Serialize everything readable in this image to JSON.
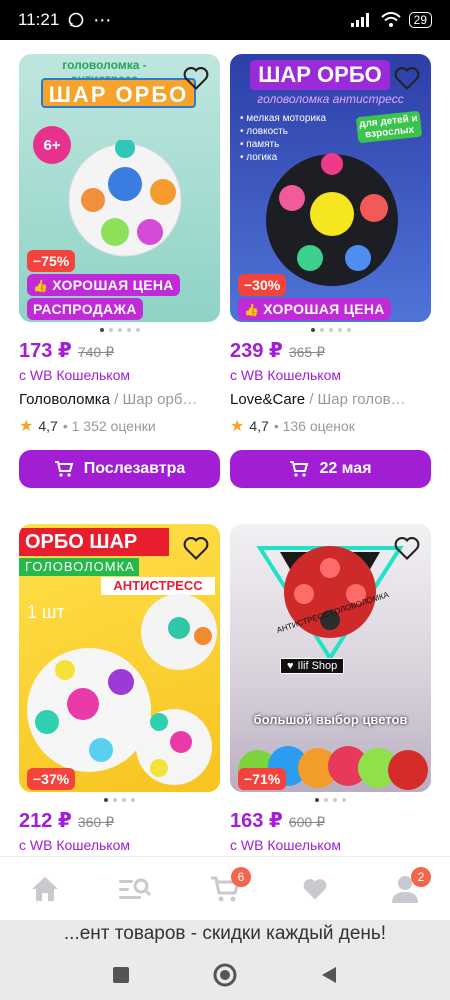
{
  "status": {
    "time": "11:21",
    "battery": "29"
  },
  "products": [
    {
      "img_text_top": "головоломка - антистресс",
      "img_text_main": "ШАР ОРБО",
      "age": "6+",
      "discount": "−75%",
      "tag1": "ХОРОШАЯ ЦЕНА",
      "tag2": "РАСПРОДАЖА",
      "price": "173 ₽",
      "old_price": "740 ₽",
      "wallet": "с WB Кошельком",
      "brand": "Головоломка",
      "name": " / Шар орб…",
      "rating": "4,7",
      "reviews": "• 1 352 оценки",
      "button": "Послезавтра"
    },
    {
      "img_text_main": "ШАР ОРБО",
      "img_text_top": "головоломка антистресс",
      "features": [
        "• мелкая моторика",
        "• ловкость",
        "• память",
        "• логика"
      ],
      "age": "для детей и взрослых",
      "discount": "−30%",
      "tag1": "ХОРОШАЯ ЦЕНА",
      "price": "239 ₽",
      "old_price": "365 ₽",
      "wallet": "с WB Кошельком",
      "brand": "Love&Care",
      "name": " / Шар голов…",
      "rating": "4,7",
      "reviews": "• 136 оценок",
      "button": "22 мая"
    },
    {
      "img_text_top": "ОРБО ШАР",
      "img_text_sub": "ГОЛОВОЛОМКА",
      "img_text_sub2": "АНТИСТРЕСС",
      "qty": "1 шт",
      "discount": "−37%",
      "price": "212 ₽",
      "old_price": "360 ₽",
      "wallet": "с WB Кошельком"
    },
    {
      "shop": "Ilif Shop",
      "ring": "АНТИСТРЕСС ГОЛОВОЛОМКА",
      "img_text_bottom": "большой выбор цветов",
      "discount": "−71%",
      "price": "163 ₽",
      "old_price": "600 ₽",
      "wallet": "с WB Кошельком"
    }
  ],
  "tabs": {
    "cart_badge": "6",
    "profile_badge": "2"
  },
  "ticker": "...ент товаров - скидки каждый день!",
  "colors": {
    "accent": "#a11ed4",
    "discount": "#f2433c",
    "tag": "#c02ad8"
  }
}
